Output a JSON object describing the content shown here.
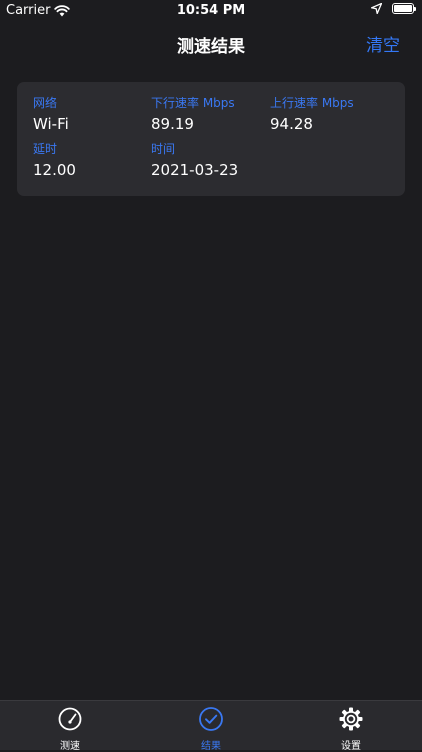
{
  "status_bar": {
    "carrier": "Carrier",
    "time": "10:54 PM"
  },
  "nav": {
    "title": "测速结果",
    "clear_label": "清空"
  },
  "result": {
    "network_label": "网络",
    "network_value": "Wi-Fi",
    "download_label": "下行速率 Mbps",
    "download_value": "89.19",
    "upload_label": "上行速率 Mbps",
    "upload_value": "94.28",
    "latency_label": "延时",
    "latency_value": "12.00",
    "time_label": "时间",
    "time_value": "2021-03-23"
  },
  "tabs": [
    {
      "label": "测速",
      "icon": "speedometer-icon",
      "active": false
    },
    {
      "label": "结果",
      "icon": "check-circle-icon",
      "active": true
    },
    {
      "label": "设置",
      "icon": "gear-icon",
      "active": false
    }
  ],
  "colors": {
    "accent": "#3478f6",
    "background": "#1c1c1f",
    "card": "#2c2c30",
    "tab_bar": "#2a2a2e"
  }
}
